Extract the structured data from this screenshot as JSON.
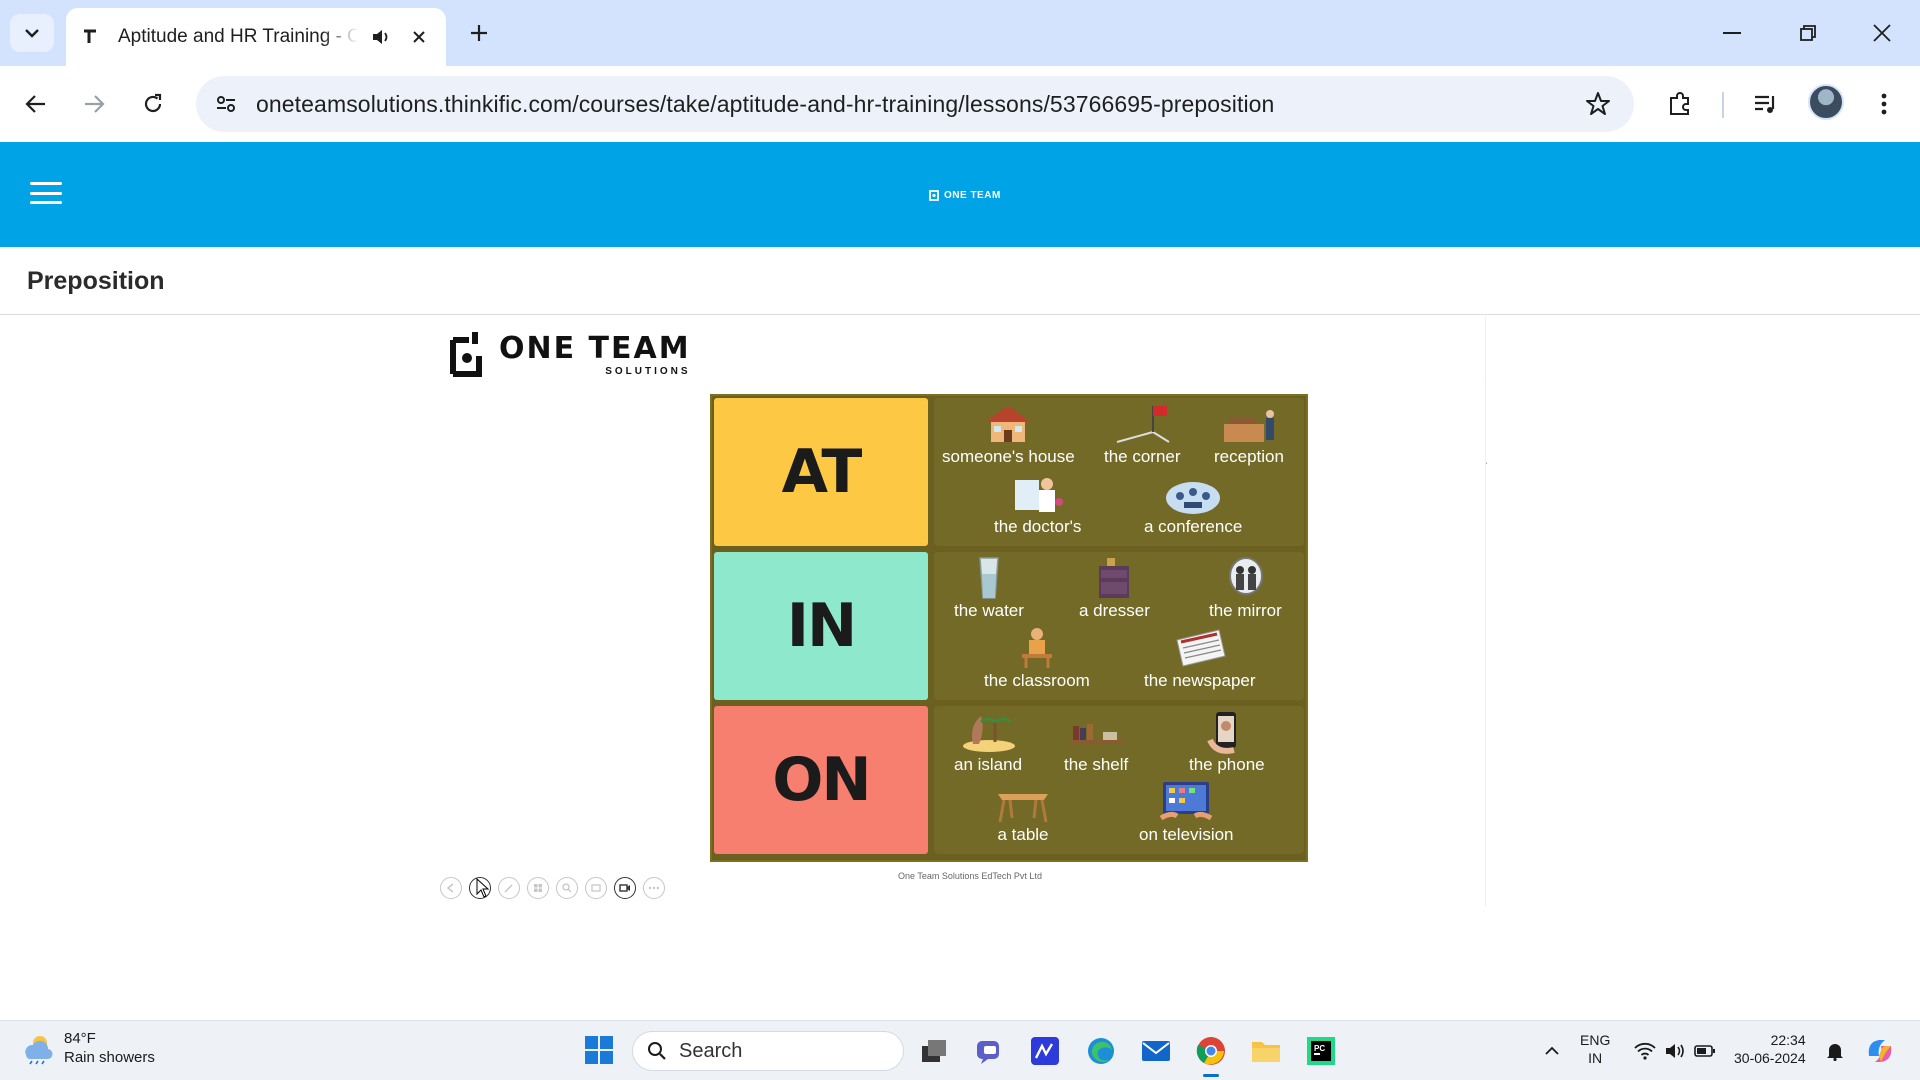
{
  "browser": {
    "tab": {
      "title": "Aptitude and HR Training - One Team Solutions"
    },
    "url": "oneteamsolutions.thinkific.com/courses/take/aptitude-and-hr-training/lessons/53766695-preposition"
  },
  "site": {
    "logo_text": "ONE TEAM",
    "lesson_title": "Preposition"
  },
  "slide": {
    "logo": {
      "main": "ONE TEAM",
      "sub": "SOLUTIONS"
    },
    "rows": [
      {
        "label": "AT",
        "color": "#fdc843",
        "items": [
          {
            "label": "someone's house",
            "icon": "house-icon"
          },
          {
            "label": "the corner",
            "icon": "corner-flag-icon"
          },
          {
            "label": "reception",
            "icon": "reception-desk-icon"
          },
          {
            "label": "the doctor's",
            "icon": "doctor-icon"
          },
          {
            "label": "a conference",
            "icon": "conference-icon"
          }
        ]
      },
      {
        "label": "IN",
        "color": "#8ee8cc",
        "items": [
          {
            "label": "the water",
            "icon": "glass-of-water-icon"
          },
          {
            "label": "a dresser",
            "icon": "dresser-icon"
          },
          {
            "label": "the mirror",
            "icon": "mirror-icon"
          },
          {
            "label": "the classroom",
            "icon": "classroom-icon"
          },
          {
            "label": "the newspaper",
            "icon": "newspaper-icon"
          }
        ]
      },
      {
        "label": "ON",
        "color": "#f77f6f",
        "items": [
          {
            "label": "an island",
            "icon": "island-icon"
          },
          {
            "label": "the shelf",
            "icon": "shelf-icon"
          },
          {
            "label": "the phone",
            "icon": "phone-icon"
          },
          {
            "label": "a table",
            "icon": "table-icon"
          },
          {
            "label": "on television",
            "icon": "television-icon"
          }
        ]
      }
    ],
    "footer": "One Team Solutions EdTech Pvt Ltd"
  },
  "taskbar": {
    "weather": {
      "temp": "84°F",
      "desc": "Rain showers"
    },
    "search_label": "Search",
    "lang": {
      "line1": "ENG",
      "line2": "IN"
    },
    "clock": {
      "time": "22:34",
      "date": "30-06-2024"
    }
  },
  "colors": {
    "tabbar": "#d3e3fd",
    "site_header": "#00a3e6",
    "board": "#746a27"
  }
}
